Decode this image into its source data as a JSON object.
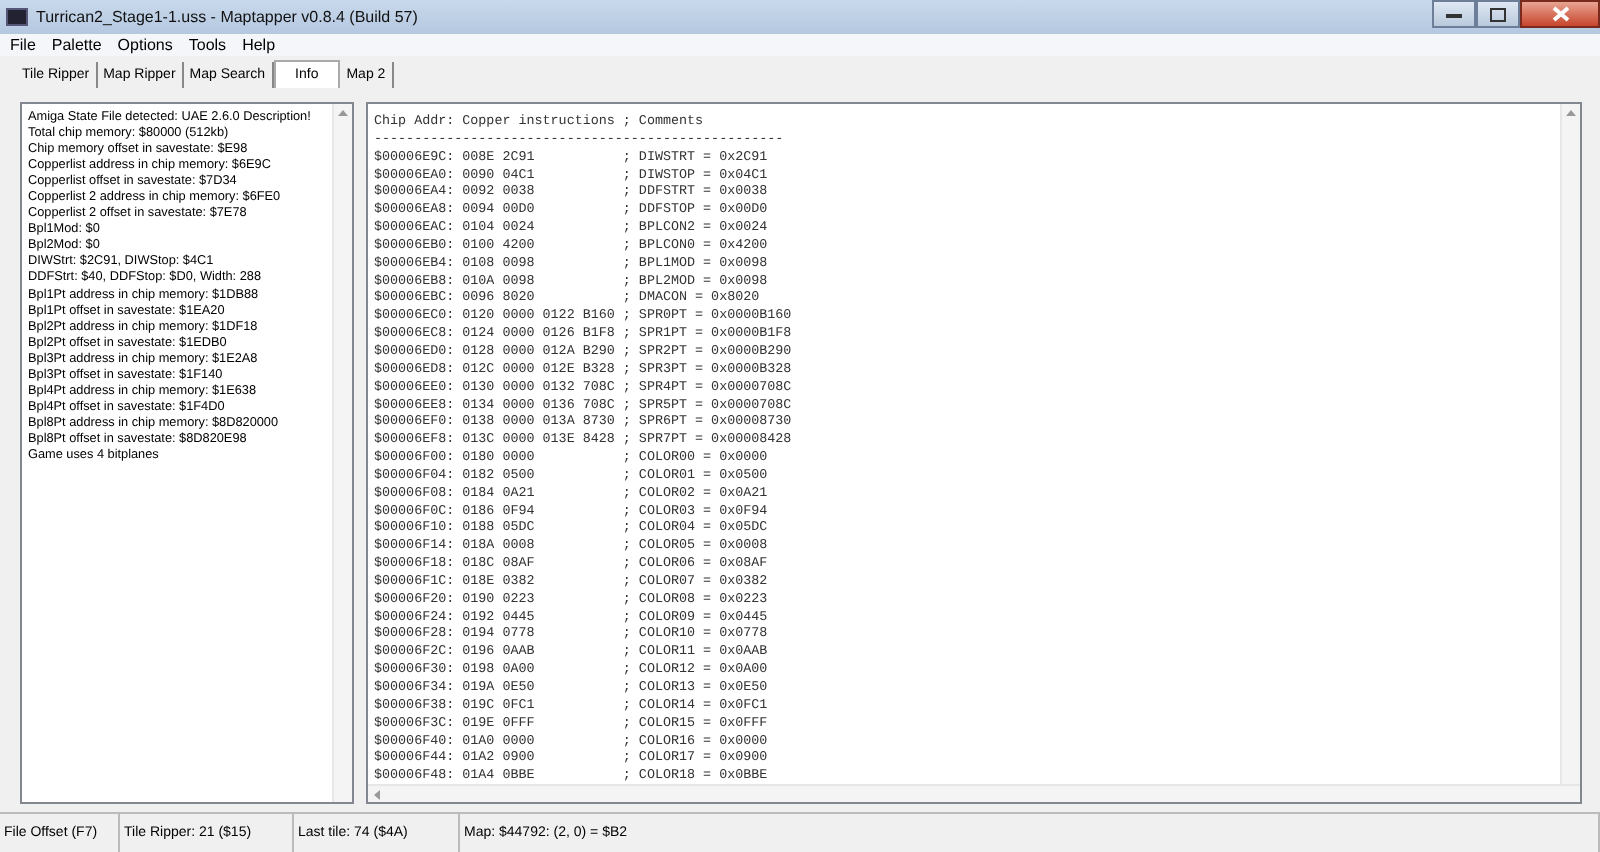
{
  "window": {
    "title": "Turrican2_Stage1-1.uss - Maptapper v0.8.4 (Build 57)"
  },
  "menu": [
    "File",
    "Palette",
    "Options",
    "Tools",
    "Help"
  ],
  "tabs": [
    {
      "label": "Tile Ripper",
      "selected": false
    },
    {
      "label": "Map Ripper",
      "selected": false
    },
    {
      "label": "Map Search",
      "selected": false
    },
    {
      "label": "Info",
      "selected": true
    },
    {
      "label": "Map 2",
      "selected": false
    }
  ],
  "info_lines": [
    "Amiga State File detected: UAE 2.6.0 Description!",
    "Total chip memory: $80000 (512kb)",
    "Chip memory offset in savestate: $E98",
    "Copperlist address in chip memory: $6E9C",
    "Copperlist offset in savestate: $7D34",
    "Copperlist 2 address in chip memory: $6FE0",
    "Copperlist 2 offset in savestate: $7E78",
    "Bpl1Mod: $0",
    "Bpl2Mod: $0",
    "DIWStrt: $2C91, DIWStop: $4C1",
    "DDFStrt: $40, DDFStop: $D0, Width: 288",
    "Bpl1Pt address in chip memory: $1DB88",
    "Bpl1Pt offset in savestate: $1EA20",
    "Bpl2Pt address in chip memory: $1DF18",
    "Bpl2Pt offset in savestate: $1EDB0",
    "Bpl3Pt address in chip memory: $1E2A8",
    "Bpl3Pt offset in savestate: $1F140",
    "Bpl4Pt address in chip memory: $1E638",
    "Bpl4Pt offset in savestate: $1F4D0",
    "Bpl8Pt address in chip memory: $8D820000",
    "Bpl8Pt offset in savestate: $8D820E98",
    "Game uses 4 bitplanes"
  ],
  "listing": [
    "Chip Addr: Copper instructions ; Comments",
    "---------------------------------------------------",
    "$00006E9C: 008E 2C91           ; DIWSTRT = 0x2C91",
    "$00006EA0: 0090 04C1           ; DIWSTOP = 0x04C1",
    "$00006EA4: 0092 0038           ; DDFSTRT = 0x0038",
    "$00006EA8: 0094 00D0           ; DDFSTOP = 0x00D0",
    "$00006EAC: 0104 0024           ; BPLCON2 = 0x0024",
    "$00006EB0: 0100 4200           ; BPLCON0 = 0x4200",
    "$00006EB4: 0108 0098           ; BPL1MOD = 0x0098",
    "$00006EB8: 010A 0098           ; BPL2MOD = 0x0098",
    "$00006EBC: 0096 8020           ; DMACON = 0x8020",
    "$00006EC0: 0120 0000 0122 B160 ; SPR0PT = 0x0000B160",
    "$00006EC8: 0124 0000 0126 B1F8 ; SPR1PT = 0x0000B1F8",
    "$00006ED0: 0128 0000 012A B290 ; SPR2PT = 0x0000B290",
    "$00006ED8: 012C 0000 012E B328 ; SPR3PT = 0x0000B328",
    "$00006EE0: 0130 0000 0132 708C ; SPR4PT = 0x0000708C",
    "$00006EE8: 0134 0000 0136 708C ; SPR5PT = 0x0000708C",
    "$00006EF0: 0138 0000 013A 8730 ; SPR6PT = 0x00008730",
    "$00006EF8: 013C 0000 013E 8428 ; SPR7PT = 0x00008428",
    "$00006F00: 0180 0000           ; COLOR00 = 0x0000",
    "$00006F04: 0182 0500           ; COLOR01 = 0x0500",
    "$00006F08: 0184 0A21           ; COLOR02 = 0x0A21",
    "$00006F0C: 0186 0F94           ; COLOR03 = 0x0F94",
    "$00006F10: 0188 05DC           ; COLOR04 = 0x05DC",
    "$00006F14: 018A 0008           ; COLOR05 = 0x0008",
    "$00006F18: 018C 08AF           ; COLOR06 = 0x08AF",
    "$00006F1C: 018E 0382           ; COLOR07 = 0x0382",
    "$00006F20: 0190 0223           ; COLOR08 = 0x0223",
    "$00006F24: 0192 0445           ; COLOR09 = 0x0445",
    "$00006F28: 0194 0778           ; COLOR10 = 0x0778",
    "$00006F2C: 0196 0AAB           ; COLOR11 = 0x0AAB",
    "$00006F30: 0198 0A00           ; COLOR12 = 0x0A00",
    "$00006F34: 019A 0E50           ; COLOR13 = 0x0E50",
    "$00006F38: 019C 0FC1           ; COLOR14 = 0x0FC1",
    "$00006F3C: 019E 0FFF           ; COLOR15 = 0x0FFF",
    "$00006F40: 01A0 0000           ; COLOR16 = 0x0000",
    "$00006F44: 01A2 0900           ; COLOR17 = 0x0900",
    "$00006F48: 01A4 0BBE           ; COLOR18 = 0x0BBE"
  ],
  "status_bar": [
    "File Offset (F7)",
    "Tile Ripper: 21 ($15)",
    "Last tile: 74 ($4A)",
    "Map: $44792: (2, 0) = $B2"
  ]
}
